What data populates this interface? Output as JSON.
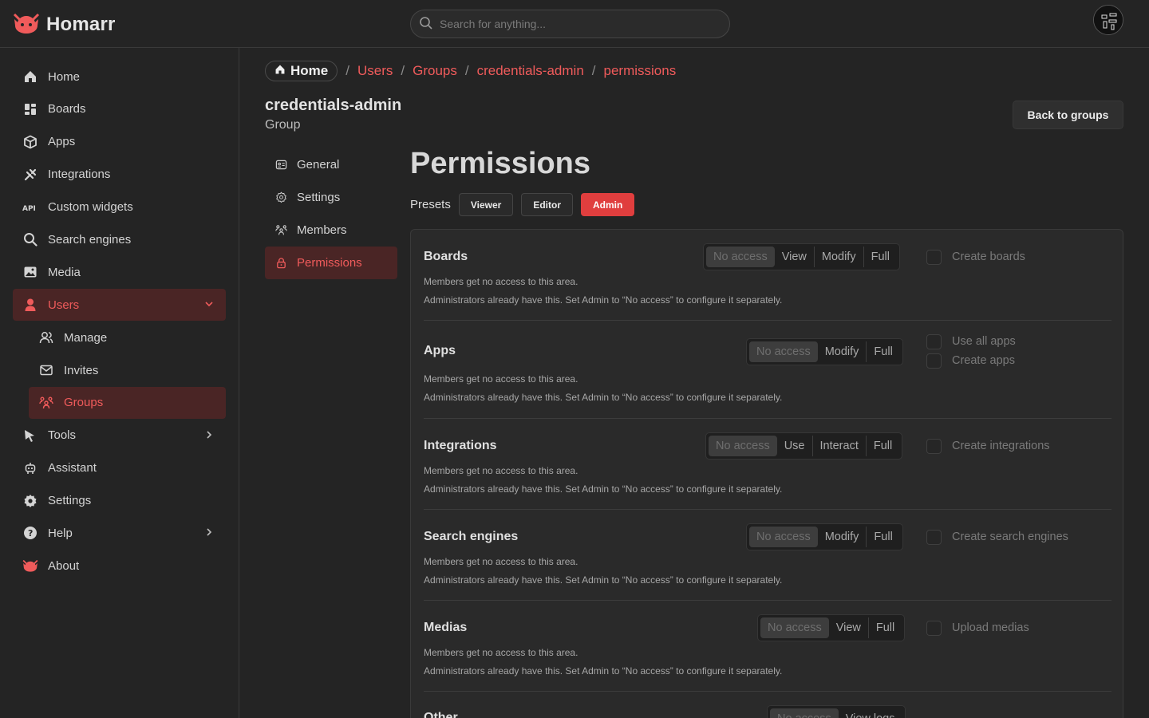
{
  "app": {
    "name": "Homarr"
  },
  "search": {
    "placeholder": "Search for anything..."
  },
  "sidebar": {
    "items": [
      {
        "label": "Home",
        "icon": "home-icon"
      },
      {
        "label": "Boards",
        "icon": "boards-icon"
      },
      {
        "label": "Apps",
        "icon": "box-icon"
      },
      {
        "label": "Integrations",
        "icon": "plug-icon"
      },
      {
        "label": "Custom widgets",
        "icon": "api-icon"
      },
      {
        "label": "Search engines",
        "icon": "search-icon"
      },
      {
        "label": "Media",
        "icon": "photo-icon"
      },
      {
        "label": "Users",
        "icon": "user-icon"
      },
      {
        "label": "Manage",
        "icon": "users-icon"
      },
      {
        "label": "Invites",
        "icon": "mail-icon"
      },
      {
        "label": "Groups",
        "icon": "group-icon"
      },
      {
        "label": "Tools",
        "icon": "tools-icon"
      },
      {
        "label": "Assistant",
        "icon": "robot-icon"
      },
      {
        "label": "Settings",
        "icon": "gear-icon"
      },
      {
        "label": "Help",
        "icon": "help-icon"
      },
      {
        "label": "About",
        "icon": "logo-icon"
      }
    ]
  },
  "breadcrumb": {
    "home": "Home",
    "items": [
      "Users",
      "Groups",
      "credentials-admin",
      "permissions"
    ],
    "sep": "/"
  },
  "group": {
    "name": "credentials-admin",
    "type": "Group",
    "back_label": "Back to groups"
  },
  "subnav": {
    "items": [
      "General",
      "Settings",
      "Members",
      "Permissions"
    ]
  },
  "permissions": {
    "title": "Permissions",
    "presets_label": "Presets",
    "presets": [
      "Viewer",
      "Editor",
      "Admin"
    ],
    "desc_line1": "Members get no access to this area.",
    "desc_line2": "Administrators already have this. Set Admin to “No access” to configure it separately.",
    "sections": [
      {
        "title": "Boards",
        "options": [
          "No access",
          "View",
          "Modify",
          "Full"
        ],
        "checks": [
          "Create boards"
        ]
      },
      {
        "title": "Apps",
        "options": [
          "No access",
          "Modify",
          "Full"
        ],
        "checks": [
          "Use all apps",
          "Create apps"
        ]
      },
      {
        "title": "Integrations",
        "options": [
          "No access",
          "Use",
          "Interact",
          "Full"
        ],
        "checks": [
          "Create integrations"
        ]
      },
      {
        "title": "Search engines",
        "options": [
          "No access",
          "Modify",
          "Full"
        ],
        "checks": [
          "Create search engines"
        ]
      },
      {
        "title": "Medias",
        "options": [
          "No access",
          "View",
          "Full"
        ],
        "checks": [
          "Upload medias"
        ]
      },
      {
        "title": "Other",
        "options": [
          "No access",
          "View logs"
        ],
        "checks": []
      }
    ]
  },
  "colors": {
    "accent": "#f05b5b",
    "admin_button": "#e03e3e",
    "active_bg": "#4a2525"
  }
}
